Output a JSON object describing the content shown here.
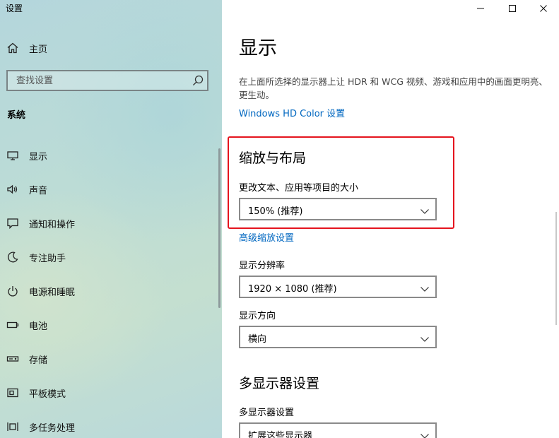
{
  "window": {
    "title": "设置",
    "controls": {
      "minimize": "minimize",
      "maximize": "maximize",
      "close": "close"
    }
  },
  "sidebar": {
    "home_label": "主页",
    "search_placeholder": "查找设置",
    "section_heading": "系统",
    "items": [
      {
        "label": "显示",
        "icon": "monitor-icon"
      },
      {
        "label": "声音",
        "icon": "speaker-icon"
      },
      {
        "label": "通知和操作",
        "icon": "message-icon"
      },
      {
        "label": "专注助手",
        "icon": "moon-icon"
      },
      {
        "label": "电源和睡眠",
        "icon": "power-icon"
      },
      {
        "label": "电池",
        "icon": "battery-icon"
      },
      {
        "label": "存储",
        "icon": "storage-icon"
      },
      {
        "label": "平板模式",
        "icon": "tablet-icon"
      },
      {
        "label": "多任务处理",
        "icon": "multitask-icon"
      }
    ]
  },
  "main": {
    "title": "显示",
    "description": "在上面所选择的显示器上让 HDR 和 WCG 视频、游戏和应用中的画面更明亮、更生动。",
    "hd_color_link": "Windows HD Color 设置",
    "scale_section": {
      "title": "缩放与布局",
      "scale_label": "更改文本、应用等项目的大小",
      "scale_value": "150% (推荐)",
      "advanced_link": "高级缩放设置",
      "resolution_label": "显示分辨率",
      "resolution_value": "1920 × 1080 (推荐)",
      "orientation_label": "显示方向",
      "orientation_value": "横向"
    },
    "multi_section": {
      "title": "多显示器设置",
      "label": "多显示器设置",
      "value": "扩展这些显示器"
    }
  },
  "colors": {
    "accent_link": "#0067c0",
    "highlight_border": "#e5141e"
  }
}
